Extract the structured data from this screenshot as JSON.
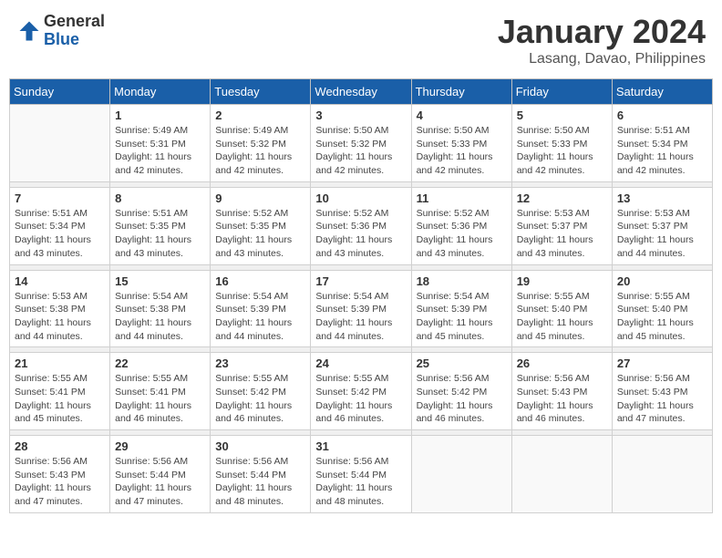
{
  "header": {
    "logo_general": "General",
    "logo_blue": "Blue",
    "month_title": "January 2024",
    "location": "Lasang, Davao, Philippines"
  },
  "days_of_week": [
    "Sunday",
    "Monday",
    "Tuesday",
    "Wednesday",
    "Thursday",
    "Friday",
    "Saturday"
  ],
  "weeks": [
    [
      {
        "day": "",
        "sunrise": "",
        "sunset": "",
        "daylight": ""
      },
      {
        "day": "1",
        "sunrise": "Sunrise: 5:49 AM",
        "sunset": "Sunset: 5:31 PM",
        "daylight": "Daylight: 11 hours and 42 minutes."
      },
      {
        "day": "2",
        "sunrise": "Sunrise: 5:49 AM",
        "sunset": "Sunset: 5:32 PM",
        "daylight": "Daylight: 11 hours and 42 minutes."
      },
      {
        "day": "3",
        "sunrise": "Sunrise: 5:50 AM",
        "sunset": "Sunset: 5:32 PM",
        "daylight": "Daylight: 11 hours and 42 minutes."
      },
      {
        "day": "4",
        "sunrise": "Sunrise: 5:50 AM",
        "sunset": "Sunset: 5:33 PM",
        "daylight": "Daylight: 11 hours and 42 minutes."
      },
      {
        "day": "5",
        "sunrise": "Sunrise: 5:50 AM",
        "sunset": "Sunset: 5:33 PM",
        "daylight": "Daylight: 11 hours and 42 minutes."
      },
      {
        "day": "6",
        "sunrise": "Sunrise: 5:51 AM",
        "sunset": "Sunset: 5:34 PM",
        "daylight": "Daylight: 11 hours and 42 minutes."
      }
    ],
    [
      {
        "day": "7",
        "sunrise": "Sunrise: 5:51 AM",
        "sunset": "Sunset: 5:34 PM",
        "daylight": "Daylight: 11 hours and 43 minutes."
      },
      {
        "day": "8",
        "sunrise": "Sunrise: 5:51 AM",
        "sunset": "Sunset: 5:35 PM",
        "daylight": "Daylight: 11 hours and 43 minutes."
      },
      {
        "day": "9",
        "sunrise": "Sunrise: 5:52 AM",
        "sunset": "Sunset: 5:35 PM",
        "daylight": "Daylight: 11 hours and 43 minutes."
      },
      {
        "day": "10",
        "sunrise": "Sunrise: 5:52 AM",
        "sunset": "Sunset: 5:36 PM",
        "daylight": "Daylight: 11 hours and 43 minutes."
      },
      {
        "day": "11",
        "sunrise": "Sunrise: 5:52 AM",
        "sunset": "Sunset: 5:36 PM",
        "daylight": "Daylight: 11 hours and 43 minutes."
      },
      {
        "day": "12",
        "sunrise": "Sunrise: 5:53 AM",
        "sunset": "Sunset: 5:37 PM",
        "daylight": "Daylight: 11 hours and 43 minutes."
      },
      {
        "day": "13",
        "sunrise": "Sunrise: 5:53 AM",
        "sunset": "Sunset: 5:37 PM",
        "daylight": "Daylight: 11 hours and 44 minutes."
      }
    ],
    [
      {
        "day": "14",
        "sunrise": "Sunrise: 5:53 AM",
        "sunset": "Sunset: 5:38 PM",
        "daylight": "Daylight: 11 hours and 44 minutes."
      },
      {
        "day": "15",
        "sunrise": "Sunrise: 5:54 AM",
        "sunset": "Sunset: 5:38 PM",
        "daylight": "Daylight: 11 hours and 44 minutes."
      },
      {
        "day": "16",
        "sunrise": "Sunrise: 5:54 AM",
        "sunset": "Sunset: 5:39 PM",
        "daylight": "Daylight: 11 hours and 44 minutes."
      },
      {
        "day": "17",
        "sunrise": "Sunrise: 5:54 AM",
        "sunset": "Sunset: 5:39 PM",
        "daylight": "Daylight: 11 hours and 44 minutes."
      },
      {
        "day": "18",
        "sunrise": "Sunrise: 5:54 AM",
        "sunset": "Sunset: 5:39 PM",
        "daylight": "Daylight: 11 hours and 45 minutes."
      },
      {
        "day": "19",
        "sunrise": "Sunrise: 5:55 AM",
        "sunset": "Sunset: 5:40 PM",
        "daylight": "Daylight: 11 hours and 45 minutes."
      },
      {
        "day": "20",
        "sunrise": "Sunrise: 5:55 AM",
        "sunset": "Sunset: 5:40 PM",
        "daylight": "Daylight: 11 hours and 45 minutes."
      }
    ],
    [
      {
        "day": "21",
        "sunrise": "Sunrise: 5:55 AM",
        "sunset": "Sunset: 5:41 PM",
        "daylight": "Daylight: 11 hours and 45 minutes."
      },
      {
        "day": "22",
        "sunrise": "Sunrise: 5:55 AM",
        "sunset": "Sunset: 5:41 PM",
        "daylight": "Daylight: 11 hours and 46 minutes."
      },
      {
        "day": "23",
        "sunrise": "Sunrise: 5:55 AM",
        "sunset": "Sunset: 5:42 PM",
        "daylight": "Daylight: 11 hours and 46 minutes."
      },
      {
        "day": "24",
        "sunrise": "Sunrise: 5:55 AM",
        "sunset": "Sunset: 5:42 PM",
        "daylight": "Daylight: 11 hours and 46 minutes."
      },
      {
        "day": "25",
        "sunrise": "Sunrise: 5:56 AM",
        "sunset": "Sunset: 5:42 PM",
        "daylight": "Daylight: 11 hours and 46 minutes."
      },
      {
        "day": "26",
        "sunrise": "Sunrise: 5:56 AM",
        "sunset": "Sunset: 5:43 PM",
        "daylight": "Daylight: 11 hours and 46 minutes."
      },
      {
        "day": "27",
        "sunrise": "Sunrise: 5:56 AM",
        "sunset": "Sunset: 5:43 PM",
        "daylight": "Daylight: 11 hours and 47 minutes."
      }
    ],
    [
      {
        "day": "28",
        "sunrise": "Sunrise: 5:56 AM",
        "sunset": "Sunset: 5:43 PM",
        "daylight": "Daylight: 11 hours and 47 minutes."
      },
      {
        "day": "29",
        "sunrise": "Sunrise: 5:56 AM",
        "sunset": "Sunset: 5:44 PM",
        "daylight": "Daylight: 11 hours and 47 minutes."
      },
      {
        "day": "30",
        "sunrise": "Sunrise: 5:56 AM",
        "sunset": "Sunset: 5:44 PM",
        "daylight": "Daylight: 11 hours and 48 minutes."
      },
      {
        "day": "31",
        "sunrise": "Sunrise: 5:56 AM",
        "sunset": "Sunset: 5:44 PM",
        "daylight": "Daylight: 11 hours and 48 minutes."
      },
      {
        "day": "",
        "sunrise": "",
        "sunset": "",
        "daylight": ""
      },
      {
        "day": "",
        "sunrise": "",
        "sunset": "",
        "daylight": ""
      },
      {
        "day": "",
        "sunrise": "",
        "sunset": "",
        "daylight": ""
      }
    ]
  ]
}
